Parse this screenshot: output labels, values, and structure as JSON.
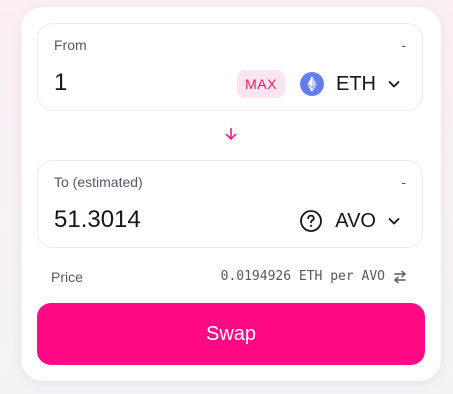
{
  "colors": {
    "accent": "#ff0a84",
    "max_bg": "#fde4ee",
    "max_text": "#e8196b",
    "eth_icon": "#627eea"
  },
  "from": {
    "label": "From",
    "balance": "-",
    "amount": "1",
    "max_label": "MAX",
    "token": {
      "symbol": "ETH",
      "icon": "ethereum-icon"
    }
  },
  "swap_direction_icon": "arrow-down-icon",
  "to": {
    "label": "To (estimated)",
    "balance": "-",
    "amount": "51.3014",
    "token": {
      "symbol": "AVO",
      "icon": "question-circle-icon"
    }
  },
  "price": {
    "label": "Price",
    "value": "0.0194926 ETH per AVO",
    "toggle_icon": "swap-horizontal-icon"
  },
  "swap_button": {
    "label": "Swap"
  }
}
